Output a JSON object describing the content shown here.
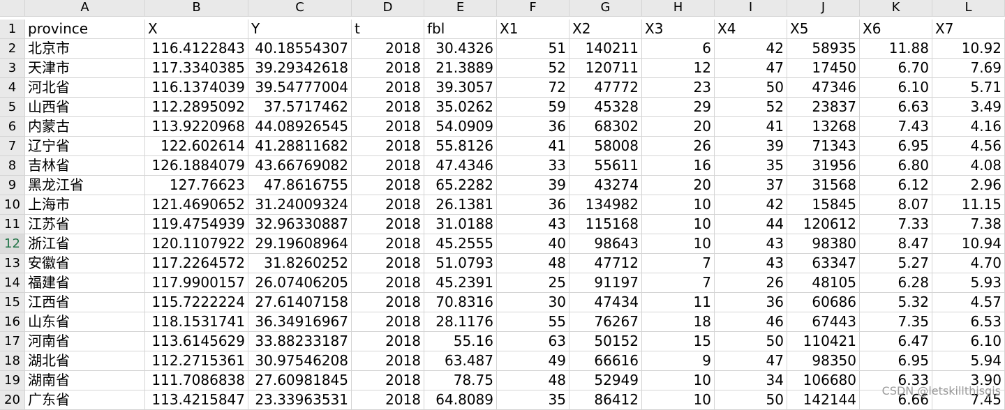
{
  "columns": [
    "A",
    "B",
    "C",
    "D",
    "E",
    "F",
    "G",
    "H",
    "I",
    "J",
    "K",
    "L"
  ],
  "active_row": "12",
  "rows": [
    {
      "n": "1",
      "cells": [
        "province",
        "X",
        "Y",
        "t",
        "fbl",
        "X1",
        "X2",
        "X3",
        "X4",
        "X5",
        "X6",
        "X7"
      ],
      "header": true
    },
    {
      "n": "2",
      "cells": [
        "北京市",
        "116.4122843",
        "40.18554307",
        "2018",
        "30.4326",
        "51",
        "140211",
        "6",
        "42",
        "58935",
        "11.88",
        "10.92"
      ]
    },
    {
      "n": "3",
      "cells": [
        "天津市",
        "117.3340385",
        "39.29342618",
        "2018",
        "21.3889",
        "52",
        "120711",
        "12",
        "47",
        "17450",
        "6.70",
        "7.69"
      ]
    },
    {
      "n": "4",
      "cells": [
        "河北省",
        "116.1374039",
        "39.54777004",
        "2018",
        "39.3057",
        "72",
        "47772",
        "23",
        "50",
        "47346",
        "6.10",
        "5.71"
      ]
    },
    {
      "n": "5",
      "cells": [
        "山西省",
        "112.2895092",
        "37.5717462",
        "2018",
        "35.0262",
        "59",
        "45328",
        "29",
        "52",
        "23837",
        "6.63",
        "3.49"
      ]
    },
    {
      "n": "6",
      "cells": [
        "内蒙古",
        "113.9220968",
        "44.08926545",
        "2018",
        "54.0909",
        "36",
        "68302",
        "20",
        "41",
        "13268",
        "7.43",
        "4.16"
      ]
    },
    {
      "n": "7",
      "cells": [
        "辽宁省",
        "122.602614",
        "41.28811682",
        "2018",
        "55.8126",
        "41",
        "58008",
        "26",
        "39",
        "71343",
        "6.95",
        "4.56"
      ]
    },
    {
      "n": "8",
      "cells": [
        "吉林省",
        "126.1884079",
        "43.66769082",
        "2018",
        "47.4346",
        "33",
        "55611",
        "16",
        "35",
        "31956",
        "6.80",
        "4.08"
      ]
    },
    {
      "n": "9",
      "cells": [
        "黑龙江省",
        "127.76623",
        "47.8616755",
        "2018",
        "65.2282",
        "39",
        "43274",
        "20",
        "37",
        "31568",
        "6.12",
        "2.96"
      ]
    },
    {
      "n": "10",
      "cells": [
        "上海市",
        "121.4690652",
        "31.24009324",
        "2018",
        "26.1381",
        "36",
        "134982",
        "10",
        "42",
        "15845",
        "8.07",
        "11.15"
      ]
    },
    {
      "n": "11",
      "cells": [
        "江苏省",
        "119.4754939",
        "32.96330887",
        "2018",
        "31.0188",
        "43",
        "115168",
        "10",
        "44",
        "120612",
        "7.33",
        "7.38"
      ]
    },
    {
      "n": "12",
      "cells": [
        "浙江省",
        "120.1107922",
        "29.19608964",
        "2018",
        "45.2555",
        "40",
        "98643",
        "10",
        "43",
        "98380",
        "8.47",
        "10.94"
      ]
    },
    {
      "n": "13",
      "cells": [
        "安徽省",
        "117.2264572",
        "31.8260252",
        "2018",
        "51.0793",
        "48",
        "47712",
        "7",
        "43",
        "63347",
        "5.27",
        "4.70"
      ]
    },
    {
      "n": "14",
      "cells": [
        "福建省",
        "117.9900157",
        "26.07406205",
        "2018",
        "45.2391",
        "25",
        "91197",
        "7",
        "26",
        "48105",
        "6.28",
        "5.93"
      ]
    },
    {
      "n": "15",
      "cells": [
        "江西省",
        "115.7222224",
        "27.61407158",
        "2018",
        "70.8316",
        "30",
        "47434",
        "11",
        "36",
        "60686",
        "5.32",
        "4.57"
      ]
    },
    {
      "n": "16",
      "cells": [
        "山东省",
        "118.1531741",
        "36.34916967",
        "2018",
        "28.1176",
        "55",
        "76267",
        "18",
        "46",
        "67443",
        "7.35",
        "6.53"
      ]
    },
    {
      "n": "17",
      "cells": [
        "河南省",
        "113.6145629",
        "33.88233187",
        "2018",
        "55.16",
        "63",
        "50152",
        "15",
        "50",
        "110421",
        "6.47",
        "6.10"
      ]
    },
    {
      "n": "18",
      "cells": [
        "湖北省",
        "112.2715361",
        "30.97546208",
        "2018",
        "63.487",
        "49",
        "66616",
        "9",
        "47",
        "98350",
        "6.95",
        "5.94"
      ]
    },
    {
      "n": "19",
      "cells": [
        "湖南省",
        "111.7086838",
        "27.60981845",
        "2018",
        "78.75",
        "48",
        "52949",
        "10",
        "34",
        "106680",
        "6.33",
        "3.90"
      ]
    },
    {
      "n": "20",
      "cells": [
        "广东省",
        "113.4215847",
        "23.33963531",
        "2018",
        "64.8089",
        "35",
        "86412",
        "10",
        "50",
        "142144",
        "6.66",
        "7.45"
      ]
    }
  ],
  "watermark": "CSDN @letskillthisgis"
}
